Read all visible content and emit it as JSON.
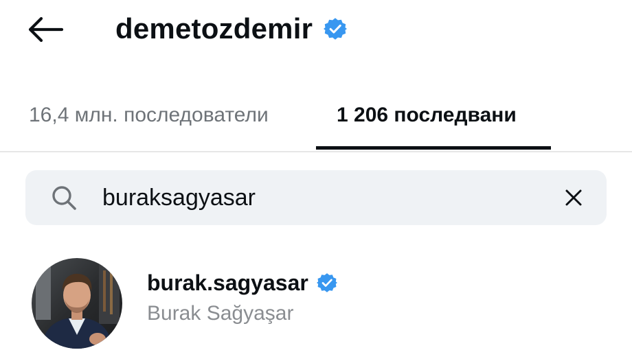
{
  "header": {
    "title": "demetozdemir",
    "back_icon": "arrow-left-icon",
    "verified_icon": "verified-badge-icon",
    "verified_color": "#3897f0"
  },
  "tabs": [
    {
      "label": "16,4 млн. последователи",
      "active": false
    },
    {
      "label": "1 206 последвани",
      "active": true
    }
  ],
  "search": {
    "value": "buraksagyasar",
    "search_icon": "search-icon",
    "clear_icon": "close-icon"
  },
  "results": [
    {
      "username": "burak.sagyasar",
      "full_name": "Burak Sağyaşar",
      "verified": true,
      "avatar_icon": "profile-photo"
    }
  ]
}
